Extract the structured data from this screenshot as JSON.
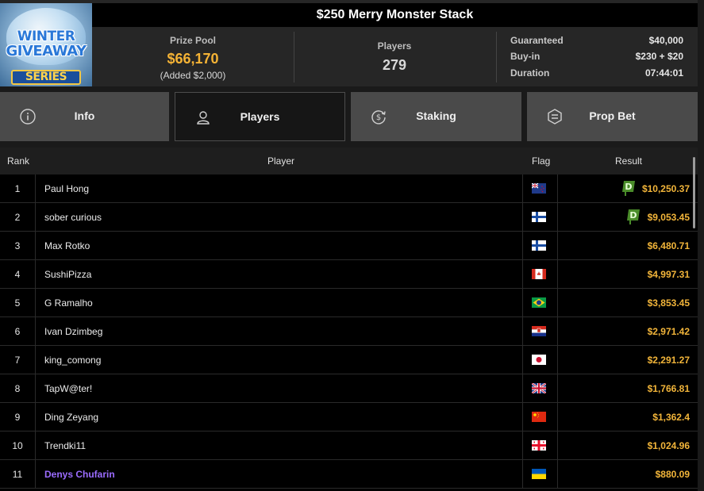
{
  "logo": {
    "line1": "WINTER",
    "line2": "GIVEAWAY",
    "line3": "SERIES"
  },
  "title": "$250 Merry Monster Stack",
  "prize_pool": {
    "label": "Prize Pool",
    "amount": "$66,170",
    "added": "(Added $2,000)"
  },
  "players_stat": {
    "label": "Players",
    "count": "279"
  },
  "details": [
    {
      "label": "Guaranteed",
      "value": "$40,000"
    },
    {
      "label": "Buy-in",
      "value": "$230 + $20"
    },
    {
      "label": "Duration",
      "value": "07:44:01"
    }
  ],
  "tabs": [
    {
      "label": "Info",
      "icon": "info-icon",
      "active": false
    },
    {
      "label": "Players",
      "icon": "user-icon",
      "active": true
    },
    {
      "label": "Staking",
      "icon": "dollar-refresh-icon",
      "active": false
    },
    {
      "label": "Prop Bet",
      "icon": "prop-bet-icon",
      "active": false
    }
  ],
  "table": {
    "headers": {
      "rank": "Rank",
      "player": "Player",
      "flag": "Flag",
      "result": "Result"
    },
    "rows": [
      {
        "rank": "1",
        "player": "Paul Hong",
        "flag": "NZ",
        "result": "$10,250.37",
        "badge": true
      },
      {
        "rank": "2",
        "player": "sober curious",
        "flag": "FI",
        "result": "$9,053.45",
        "badge": true
      },
      {
        "rank": "3",
        "player": "Max Rotko",
        "flag": "FI",
        "result": "$6,480.71"
      },
      {
        "rank": "4",
        "player": "SushiPizza",
        "flag": "CA",
        "result": "$4,997.31"
      },
      {
        "rank": "5",
        "player": "G Ramalho",
        "flag": "BR",
        "result": "$3,853.45"
      },
      {
        "rank": "6",
        "player": "Ivan Dzimbeg",
        "flag": "HR",
        "result": "$2,971.42"
      },
      {
        "rank": "7",
        "player": "king_comong",
        "flag": "JP",
        "result": "$2,291.27"
      },
      {
        "rank": "8",
        "player": "TapW@ter!",
        "flag": "GB",
        "result": "$1,766.81"
      },
      {
        "rank": "9",
        "player": "Ding Zeyang",
        "flag": "CN",
        "result": "$1,362.4"
      },
      {
        "rank": "10",
        "player": "Trendki11",
        "flag": "GE",
        "result": "$1,024.96"
      },
      {
        "rank": "11",
        "player": "Denys Chufarin",
        "flag": "UA",
        "result": "$880.09",
        "highlight": true
      }
    ]
  },
  "colors": {
    "accent": "#f5b335",
    "highlight_player": "#9b6cff",
    "badge": "#4a8c2a"
  }
}
